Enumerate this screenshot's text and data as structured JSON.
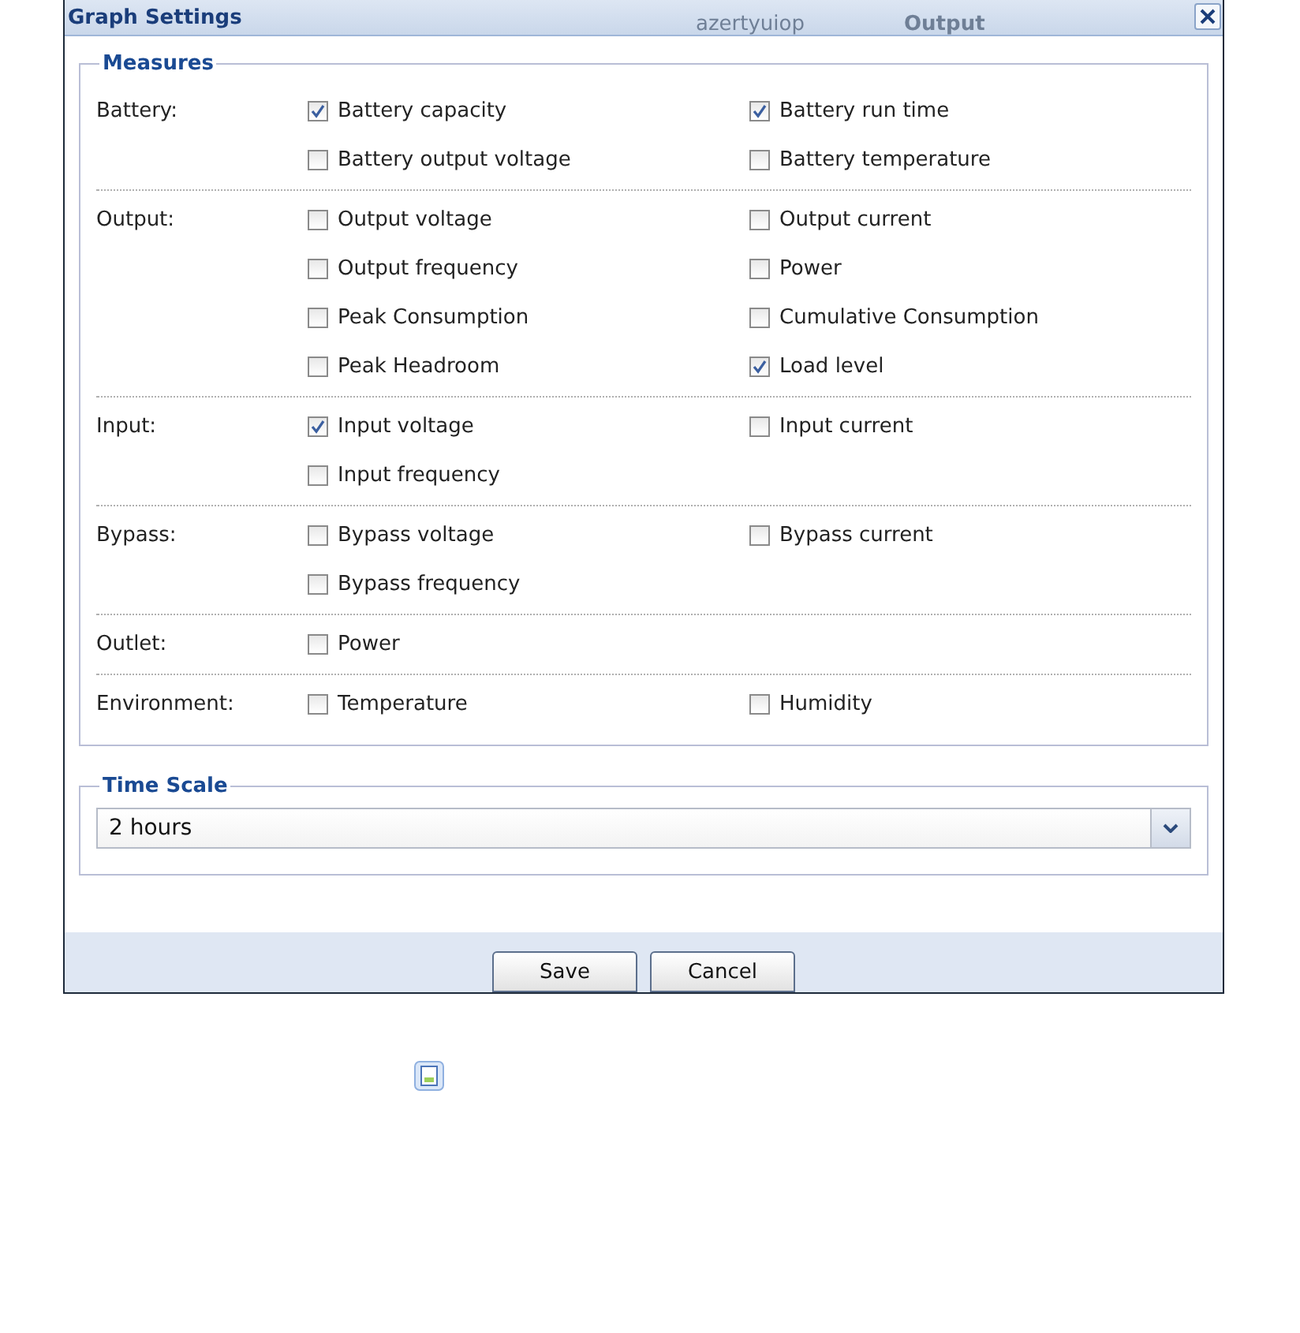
{
  "window": {
    "title": "Graph Settings",
    "background_texts": [
      "azertyuiop",
      "Output"
    ]
  },
  "measures": {
    "legend": "Measures",
    "groups": [
      {
        "label": "Battery:",
        "items": [
          {
            "label": "Battery capacity",
            "checked": true
          },
          {
            "label": "Battery run time",
            "checked": true
          },
          {
            "label": "Battery output voltage",
            "checked": false
          },
          {
            "label": "Battery temperature",
            "checked": false
          }
        ]
      },
      {
        "label": "Output:",
        "items": [
          {
            "label": "Output voltage",
            "checked": false
          },
          {
            "label": "Output current",
            "checked": false
          },
          {
            "label": "Output frequency",
            "checked": false
          },
          {
            "label": "Power",
            "checked": false
          },
          {
            "label": "Peak Consumption",
            "checked": false
          },
          {
            "label": "Cumulative Consumption",
            "checked": false
          },
          {
            "label": "Peak Headroom",
            "checked": false
          },
          {
            "label": "Load level",
            "checked": true
          }
        ]
      },
      {
        "label": "Input:",
        "items": [
          {
            "label": "Input voltage",
            "checked": true
          },
          {
            "label": "Input current",
            "checked": false
          },
          {
            "label": "Input frequency",
            "checked": false
          }
        ]
      },
      {
        "label": "Bypass:",
        "items": [
          {
            "label": "Bypass voltage",
            "checked": false
          },
          {
            "label": "Bypass current",
            "checked": false
          },
          {
            "label": "Bypass frequency",
            "checked": false
          }
        ]
      },
      {
        "label": "Outlet:",
        "items": [
          {
            "label": "Power",
            "checked": false
          }
        ]
      },
      {
        "label": "Environment:",
        "items": [
          {
            "label": "Temperature",
            "checked": false
          },
          {
            "label": "Humidity",
            "checked": false
          }
        ]
      }
    ]
  },
  "time_scale": {
    "legend": "Time Scale",
    "value": "2 hours"
  },
  "buttons": [
    "Save",
    "Cancel"
  ]
}
